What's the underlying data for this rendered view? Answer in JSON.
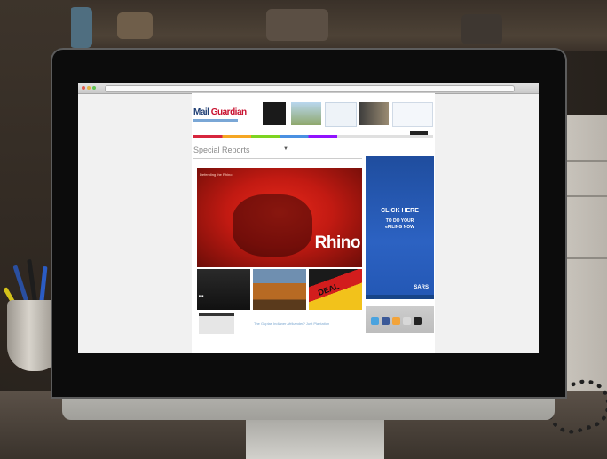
{
  "site": {
    "logo_primary": "Mail",
    "logo_secondary": "Guardian",
    "section_title": "Special Reports",
    "hero_label": "Defending the Rhino",
    "hero_title": "Rhino",
    "thumb_caption_3": "DEAL",
    "lower_link": "The Guptas Indianer Afrikander? Just Plantation"
  },
  "ad": {
    "cta_top": "CLICK HERE",
    "cta_line2": "TO DO YOUR",
    "cta_line3": "eFILING NOW",
    "brand": "SARS"
  },
  "colors": {
    "brand_blue": "#1f3e74",
    "hero_red": "#c21a12",
    "ad_blue": "#2c62c2"
  },
  "icons": [
    "apple-logo",
    "facebook-icon",
    "twitter-icon",
    "rss-icon",
    "mail-icon",
    "print-icon"
  ]
}
